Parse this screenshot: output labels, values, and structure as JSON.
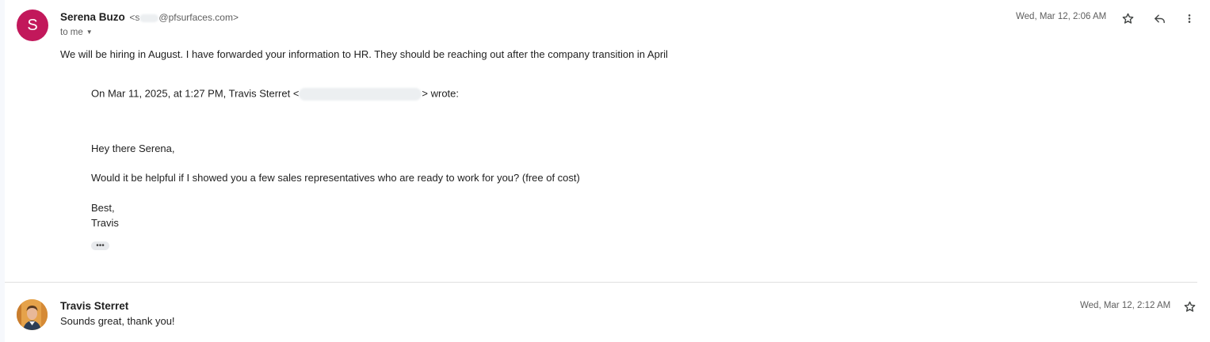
{
  "message1": {
    "avatar_letter": "S",
    "avatar_color": "#c2185b",
    "sender_name": "Serena Buzo",
    "sender_email_open": "<s",
    "sender_email_domain": "@pfsurfaces.com>",
    "recipient": "to me",
    "date": "Wed, Mar 12, 2:06 AM",
    "body": "We will be hiring in August.  I have forwarded your information to HR.   They should be reaching out after the company transition in April",
    "quote": {
      "attribution_prefix": "On Mar 11, 2025, at 1:27 PM, Travis Sterret <",
      "attribution_suffix": "> wrote:",
      "greeting": "Hey there Serena,",
      "body": "Would it be helpful if I showed you a few sales representatives who are ready to work for you? (free of cost)",
      "signoff": "Best,",
      "signature": "Travis"
    },
    "icons": [
      "star-icon",
      "reply-icon",
      "more-vert-icon"
    ]
  },
  "message2": {
    "sender_name": "Travis Sterret",
    "snippet": "Sounds great, thank you!",
    "date": "Wed, Mar 12, 2:12 AM",
    "icons": [
      "star-icon"
    ]
  }
}
